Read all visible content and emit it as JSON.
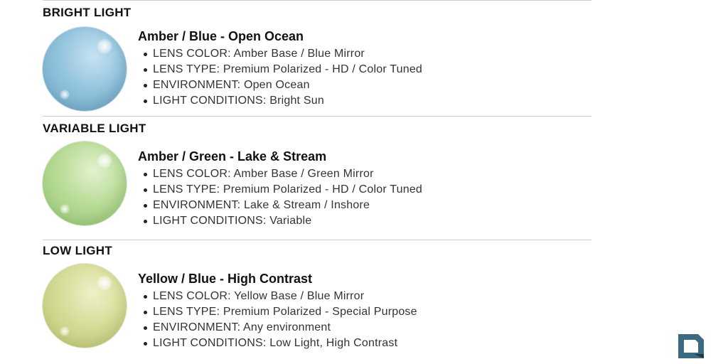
{
  "sections": [
    {
      "heading": "BRIGHT LIGHT",
      "lens_tint": "#93c4de",
      "title": "Amber / Blue - Open Ocean",
      "bullets": [
        "LENS COLOR: Amber Base / Blue Mirror",
        "LENS TYPE: Premium Polarized - HD / Color Tuned",
        "ENVIRONMENT: Open Ocean",
        "LIGHT CONDITIONS: Bright Sun"
      ]
    },
    {
      "heading": "VARIABLE LIGHT",
      "lens_tint": "#b9dc98",
      "title": "Amber / Green - Lake & Stream",
      "bullets": [
        "LENS COLOR: Amber Base / Green Mirror",
        "LENS TYPE: Premium Polarized - HD / Color Tuned",
        "ENVIRONMENT: Lake & Stream / Inshore",
        "LIGHT CONDITIONS: Variable"
      ]
    },
    {
      "heading": "LOW LIGHT",
      "lens_tint": "#d6dc98",
      "title": "Yellow / Blue - High Contrast",
      "bullets": [
        "LENS COLOR: Yellow Base / Blue Mirror",
        "LENS TYPE: Premium Polarized - Special Purpose",
        "ENVIRONMENT: Any environment",
        "LIGHT CONDITIONS: Low Light, High Contrast"
      ]
    }
  ],
  "brand": {
    "logo_icon": "brand-logo-icon",
    "logo_color": "#3d6a80"
  }
}
